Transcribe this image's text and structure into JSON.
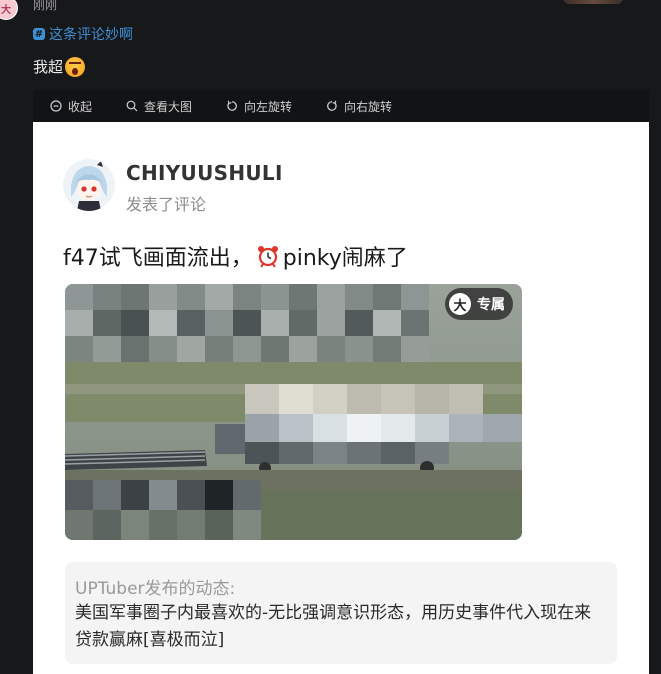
{
  "comment": {
    "username": "刚刚",
    "avatar_char": "大",
    "topic_tag": "这条评论妙啊",
    "text": "我超",
    "emoji": "shocked-face-emoji"
  },
  "viewer_toolbar": {
    "collapse_label": "收起",
    "view_large_label": "查看大图",
    "rotate_left_label": "向左旋转",
    "rotate_right_label": "向右旋转"
  },
  "card": {
    "username": "CHIYUUSHULI",
    "subtitle": "发表了评论",
    "title_part1": "f47试飞画面流出，",
    "title_emoji": "alarm-clock-emoji",
    "title_part2": "pinky闹麻了",
    "badge_icon_char": "大",
    "badge_label": "专属",
    "quote_author": "UPTuber发布的动态:",
    "quote_text": "美国军事圈子内最喜欢的-无比强调意识形态，用历史事件代入现在来贷款赢麻[喜极而泣]"
  },
  "colors": {
    "background": "#17181a",
    "topic_blue": "#3d8fd6",
    "card_bg": "#ffffff",
    "quote_bg": "#f4f4f5"
  }
}
